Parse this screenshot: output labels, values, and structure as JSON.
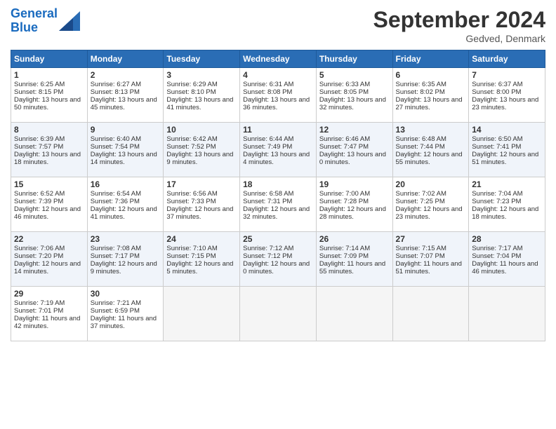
{
  "header": {
    "logo_line1": "General",
    "logo_line2": "Blue",
    "month_title": "September 2024",
    "location": "Gedved, Denmark"
  },
  "weekdays": [
    "Sunday",
    "Monday",
    "Tuesday",
    "Wednesday",
    "Thursday",
    "Friday",
    "Saturday"
  ],
  "weeks": [
    [
      {
        "day": "1",
        "sunrise": "6:25 AM",
        "sunset": "8:15 PM",
        "daylight": "13 hours and 50 minutes."
      },
      {
        "day": "2",
        "sunrise": "6:27 AM",
        "sunset": "8:13 PM",
        "daylight": "13 hours and 45 minutes."
      },
      {
        "day": "3",
        "sunrise": "6:29 AM",
        "sunset": "8:10 PM",
        "daylight": "13 hours and 41 minutes."
      },
      {
        "day": "4",
        "sunrise": "6:31 AM",
        "sunset": "8:08 PM",
        "daylight": "13 hours and 36 minutes."
      },
      {
        "day": "5",
        "sunrise": "6:33 AM",
        "sunset": "8:05 PM",
        "daylight": "13 hours and 32 minutes."
      },
      {
        "day": "6",
        "sunrise": "6:35 AM",
        "sunset": "8:02 PM",
        "daylight": "13 hours and 27 minutes."
      },
      {
        "day": "7",
        "sunrise": "6:37 AM",
        "sunset": "8:00 PM",
        "daylight": "13 hours and 23 minutes."
      }
    ],
    [
      {
        "day": "8",
        "sunrise": "6:39 AM",
        "sunset": "7:57 PM",
        "daylight": "13 hours and 18 minutes."
      },
      {
        "day": "9",
        "sunrise": "6:40 AM",
        "sunset": "7:54 PM",
        "daylight": "13 hours and 14 minutes."
      },
      {
        "day": "10",
        "sunrise": "6:42 AM",
        "sunset": "7:52 PM",
        "daylight": "13 hours and 9 minutes."
      },
      {
        "day": "11",
        "sunrise": "6:44 AM",
        "sunset": "7:49 PM",
        "daylight": "13 hours and 4 minutes."
      },
      {
        "day": "12",
        "sunrise": "6:46 AM",
        "sunset": "7:47 PM",
        "daylight": "13 hours and 0 minutes."
      },
      {
        "day": "13",
        "sunrise": "6:48 AM",
        "sunset": "7:44 PM",
        "daylight": "12 hours and 55 minutes."
      },
      {
        "day": "14",
        "sunrise": "6:50 AM",
        "sunset": "7:41 PM",
        "daylight": "12 hours and 51 minutes."
      }
    ],
    [
      {
        "day": "15",
        "sunrise": "6:52 AM",
        "sunset": "7:39 PM",
        "daylight": "12 hours and 46 minutes."
      },
      {
        "day": "16",
        "sunrise": "6:54 AM",
        "sunset": "7:36 PM",
        "daylight": "12 hours and 41 minutes."
      },
      {
        "day": "17",
        "sunrise": "6:56 AM",
        "sunset": "7:33 PM",
        "daylight": "12 hours and 37 minutes."
      },
      {
        "day": "18",
        "sunrise": "6:58 AM",
        "sunset": "7:31 PM",
        "daylight": "12 hours and 32 minutes."
      },
      {
        "day": "19",
        "sunrise": "7:00 AM",
        "sunset": "7:28 PM",
        "daylight": "12 hours and 28 minutes."
      },
      {
        "day": "20",
        "sunrise": "7:02 AM",
        "sunset": "7:25 PM",
        "daylight": "12 hours and 23 minutes."
      },
      {
        "day": "21",
        "sunrise": "7:04 AM",
        "sunset": "7:23 PM",
        "daylight": "12 hours and 18 minutes."
      }
    ],
    [
      {
        "day": "22",
        "sunrise": "7:06 AM",
        "sunset": "7:20 PM",
        "daylight": "12 hours and 14 minutes."
      },
      {
        "day": "23",
        "sunrise": "7:08 AM",
        "sunset": "7:17 PM",
        "daylight": "12 hours and 9 minutes."
      },
      {
        "day": "24",
        "sunrise": "7:10 AM",
        "sunset": "7:15 PM",
        "daylight": "12 hours and 5 minutes."
      },
      {
        "day": "25",
        "sunrise": "7:12 AM",
        "sunset": "7:12 PM",
        "daylight": "12 hours and 0 minutes."
      },
      {
        "day": "26",
        "sunrise": "7:14 AM",
        "sunset": "7:09 PM",
        "daylight": "11 hours and 55 minutes."
      },
      {
        "day": "27",
        "sunrise": "7:15 AM",
        "sunset": "7:07 PM",
        "daylight": "11 hours and 51 minutes."
      },
      {
        "day": "28",
        "sunrise": "7:17 AM",
        "sunset": "7:04 PM",
        "daylight": "11 hours and 46 minutes."
      }
    ],
    [
      {
        "day": "29",
        "sunrise": "7:19 AM",
        "sunset": "7:01 PM",
        "daylight": "11 hours and 42 minutes."
      },
      {
        "day": "30",
        "sunrise": "7:21 AM",
        "sunset": "6:59 PM",
        "daylight": "11 hours and 37 minutes."
      },
      null,
      null,
      null,
      null,
      null
    ]
  ]
}
